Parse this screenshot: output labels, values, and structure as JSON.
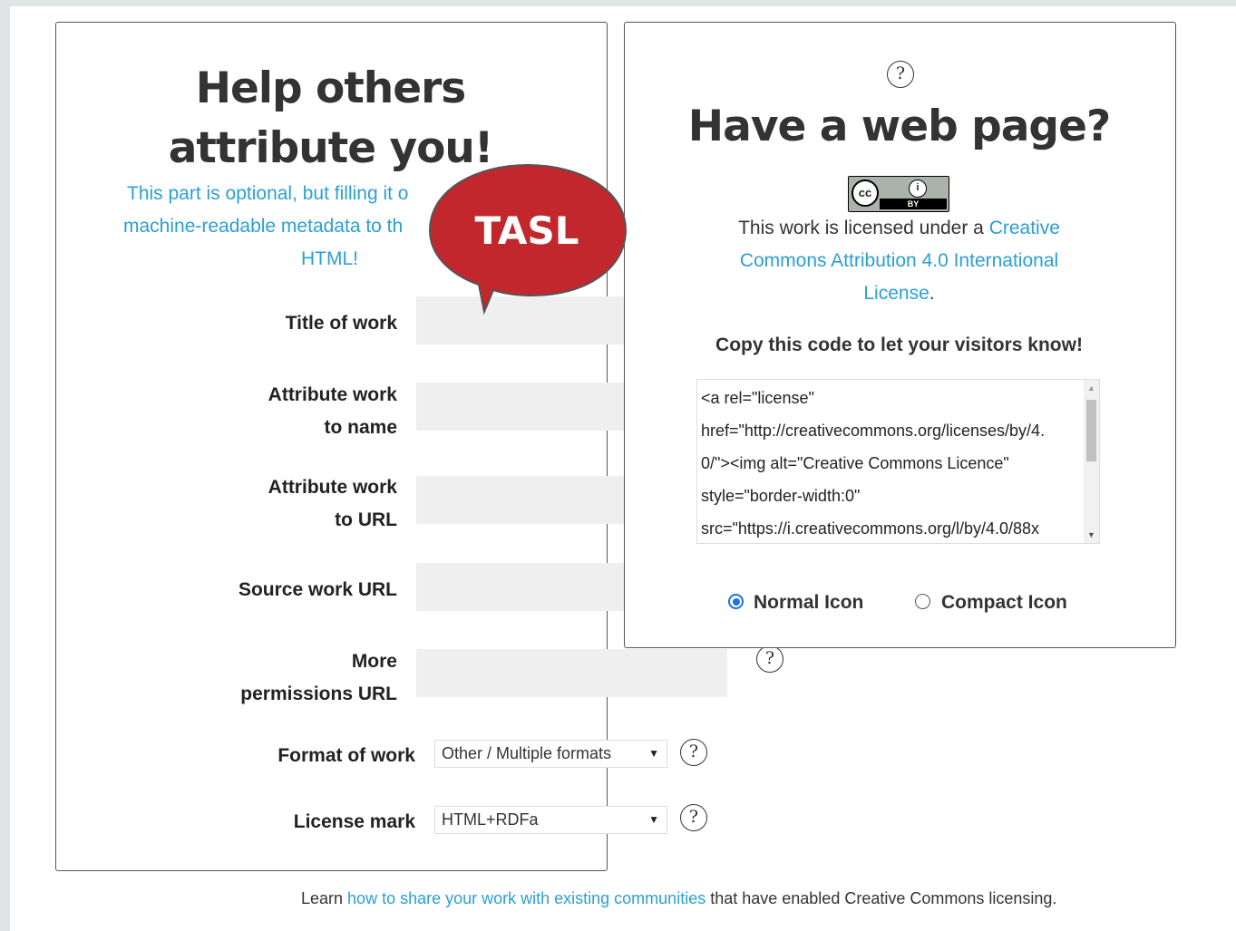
{
  "left": {
    "heading_line1": "Help others",
    "heading_line2": "attribute you!",
    "intro_line1": "This part is optional, but filling it o",
    "intro_line2": "machine-readable metadata to th",
    "intro_line3": "HTML!",
    "fields": {
      "title": "Title of work",
      "attribute_name_1": "Attribute work",
      "attribute_name_2": "to name",
      "attribute_url_1": "Attribute work",
      "attribute_url_2": "to URL",
      "source_url": "Source work URL",
      "more_perm_1": "More",
      "more_perm_2": "permissions URL",
      "format": "Format of work",
      "license_mark": "License mark"
    },
    "format_selected": "Other / Multiple formats",
    "license_mark_selected": "HTML+RDFa"
  },
  "right": {
    "heading": "Have a web page?",
    "badge_by": "BY",
    "badge_cc": "cc",
    "badge_person": "i",
    "license_prefix": "This work is licensed under a ",
    "license_link_1": "Creative",
    "license_link_2": "Commons Attribution 4.0 International",
    "license_link_3": "License",
    "license_suffix": ".",
    "copy_prompt": "Copy this code to let your visitors know!",
    "code_lines": [
      "<a rel=\"license\"",
      "href=\"http://creativecommons.org/licenses/by/4.",
      "0/\"><img alt=\"Creative Commons Licence\"",
      "style=\"border-width:0\"",
      "src=\"https://i.creativecommons.org/l/by/4.0/88x"
    ],
    "icon_options": {
      "normal": "Normal Icon",
      "compact": "Compact Icon"
    }
  },
  "tasl_label": "TASL",
  "help_glyph": "?",
  "footer": {
    "prefix": "Learn ",
    "link": "how to share your work with existing communities",
    "suffix": " that have enabled Creative Commons licensing."
  },
  "colors": {
    "link": "#2a9fd6",
    "bubble": "#c1272d",
    "gutter": "#dfe5e5"
  }
}
